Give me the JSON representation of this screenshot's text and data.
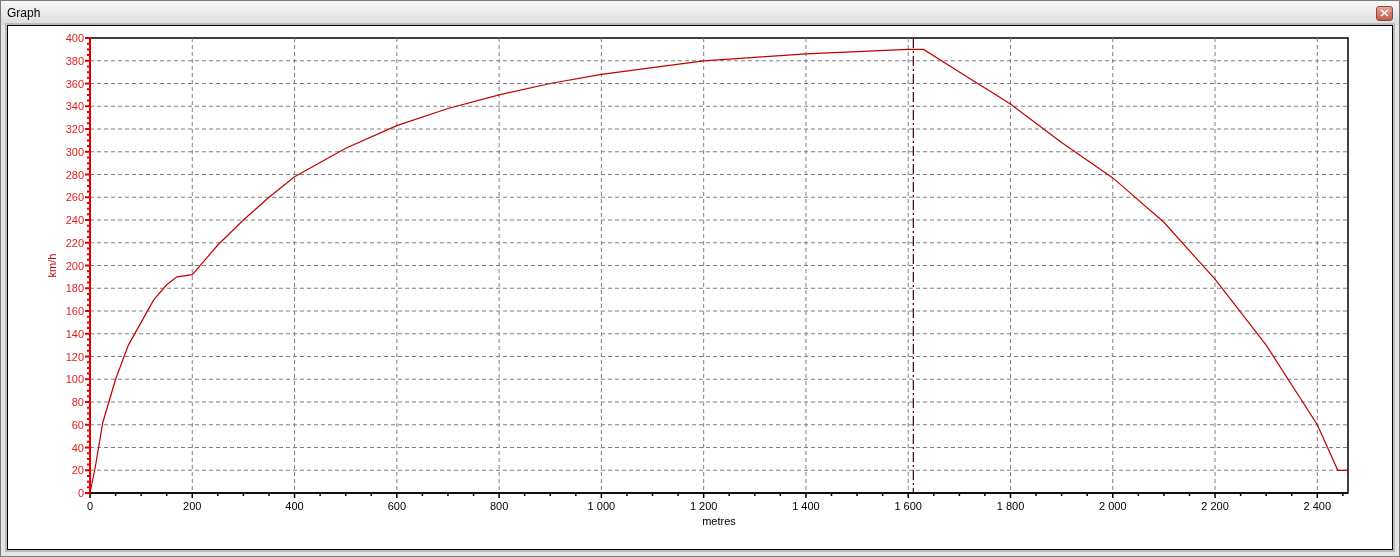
{
  "window": {
    "title": "Graph"
  },
  "chart_data": {
    "type": "line",
    "xlabel": "metres",
    "ylabel": "km/h",
    "xlim": [
      0,
      2460
    ],
    "ylim": [
      0,
      400
    ],
    "x": [
      0,
      10,
      25,
      50,
      75,
      100,
      125,
      150,
      170,
      200,
      225,
      250,
      300,
      350,
      400,
      500,
      600,
      700,
      800,
      900,
      1000,
      1100,
      1200,
      1300,
      1400,
      1500,
      1600,
      1630,
      1700,
      1800,
      1900,
      2000,
      2100,
      2200,
      2300,
      2400,
      2440,
      2460
    ],
    "series": [
      {
        "color": "#c00000",
        "values": [
          0,
          22,
          62,
          100,
          130,
          150,
          170,
          183,
          190,
          192,
          205,
          218,
          240,
          260,
          278,
          303,
          323,
          338,
          350,
          360,
          368,
          374,
          380,
          383,
          386,
          388,
          390,
          390,
          370,
          342,
          308,
          277,
          238,
          188,
          130,
          60,
          20,
          20
        ]
      }
    ],
    "xticks": [
      {
        "value": 0,
        "label": "0"
      },
      {
        "value": 200,
        "label": "200"
      },
      {
        "value": 400,
        "label": "400"
      },
      {
        "value": 600,
        "label": "600"
      },
      {
        "value": 800,
        "label": "800"
      },
      {
        "value": 1000,
        "label": "1 000"
      },
      {
        "value": 1200,
        "label": "1 200"
      },
      {
        "value": 1400,
        "label": "1 400"
      },
      {
        "value": 1600,
        "label": "1 600"
      },
      {
        "value": 1800,
        "label": "1 800"
      },
      {
        "value": 2000,
        "label": "2 000"
      },
      {
        "value": 2200,
        "label": "2 200"
      },
      {
        "value": 2400,
        "label": "2 400"
      }
    ],
    "yticks": [
      0,
      20,
      40,
      60,
      80,
      100,
      120,
      140,
      160,
      180,
      200,
      220,
      240,
      260,
      280,
      300,
      320,
      340,
      360,
      380,
      400
    ],
    "grid": true,
    "ref_lines": [
      {
        "axis": "x",
        "value": 1610
      }
    ]
  }
}
